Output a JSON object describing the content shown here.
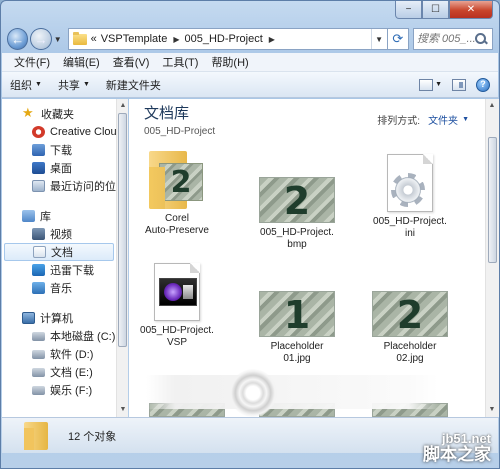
{
  "window": {
    "caption_buttons": [
      "−",
      "☐",
      "✕"
    ]
  },
  "navbar": {
    "breadcrumb_prefix": "«",
    "breadcrumbs": [
      "VSPTemplate",
      "005_HD-Project"
    ],
    "search_placeholder": "搜索 005_..."
  },
  "menubar": {
    "items": [
      "文件(F)",
      "编辑(E)",
      "查看(V)",
      "工具(T)",
      "帮助(H)"
    ]
  },
  "toolbar": {
    "organize": "组织",
    "share": "共享",
    "new_folder": "新建文件夹",
    "help": "?"
  },
  "sidebar": {
    "favorites": {
      "label": "收藏夹",
      "items": [
        "Creative Cloud",
        "下载",
        "桌面",
        "最近访问的位置"
      ]
    },
    "libraries": {
      "label": "库",
      "items": [
        "视频",
        "文档",
        "迅雷下载",
        "音乐"
      ]
    },
    "computer": {
      "label": "计算机",
      "items": [
        "本地磁盘 (C:)",
        "软件 (D:)",
        "文档 (E:)",
        "娱乐 (F:)"
      ]
    }
  },
  "content": {
    "library_title": "文档库",
    "library_subtitle": "005_HD-Project",
    "arrange_label": "排列方式:",
    "arrange_value": "文件夹",
    "files": [
      {
        "name": "Corel\nAuto-Preserve",
        "type": "folder",
        "thumb_text": "2"
      },
      {
        "name": "005_HD-Project.\nbmp",
        "type": "image",
        "thumb_text": "2"
      },
      {
        "name": "005_HD-Project.\nini",
        "type": "settings"
      },
      {
        "name": "005_HD-Project.\nVSP",
        "type": "vsp"
      },
      {
        "name": "Placeholder\n01.jpg",
        "type": "image",
        "thumb_text": "1"
      },
      {
        "name": "Placeholder\n02.jpg",
        "type": "image",
        "thumb_text": "2"
      }
    ]
  },
  "statusbar": {
    "text": "12 个对象"
  },
  "watermark": {
    "top": "jb51.net",
    "bottom": "脚本之家"
  }
}
